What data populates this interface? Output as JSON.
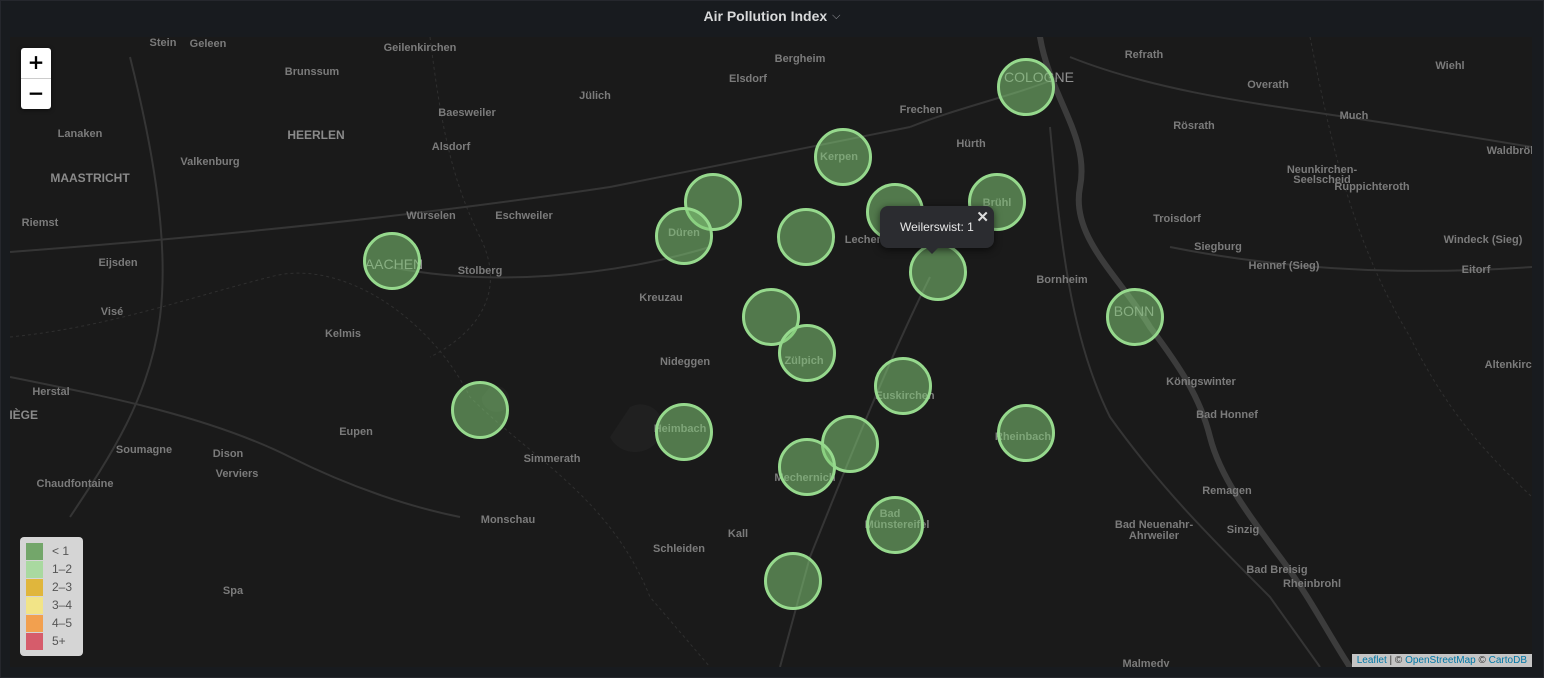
{
  "panel": {
    "title": "Air Pollution Index",
    "caret": "⌵"
  },
  "map": {
    "zoom_in": "+",
    "zoom_out": "−",
    "places": [
      {
        "name": "Stein",
        "c": "place"
      },
      {
        "name": "Geleen",
        "c": "place"
      },
      {
        "name": "Geilenkirchen",
        "c": "place"
      },
      {
        "name": "Brunssum",
        "c": "place"
      },
      {
        "name": "HEERLEN",
        "c": "place big"
      },
      {
        "name": "Lanaken",
        "c": "place"
      },
      {
        "name": "Valkenburg",
        "c": "place"
      },
      {
        "name": "MAASTRICHT",
        "c": "place big"
      },
      {
        "name": "Riemst",
        "c": "place"
      },
      {
        "name": "Eijsden",
        "c": "place"
      },
      {
        "name": "Visé",
        "c": "place"
      },
      {
        "name": "Herstal",
        "c": "place"
      },
      {
        "name": "LIÈGE",
        "c": "place big"
      },
      {
        "name": "Soumagne",
        "c": "place"
      },
      {
        "name": "Chaudfontaine",
        "c": "place"
      },
      {
        "name": "Dison",
        "c": "place"
      },
      {
        "name": "Verviers",
        "c": "place"
      },
      {
        "name": "Spa",
        "c": "place"
      },
      {
        "name": "Baesweiler",
        "c": "place"
      },
      {
        "name": "Alsdorf",
        "c": "place"
      },
      {
        "name": "Würselen",
        "c": "place"
      },
      {
        "name": "Eschweiler",
        "c": "place"
      },
      {
        "name": "Stolberg",
        "c": "place"
      },
      {
        "name": "Kelmis",
        "c": "place"
      },
      {
        "name": "Eupen",
        "c": "place"
      },
      {
        "name": "Simmerath",
        "c": "place"
      },
      {
        "name": "Monschau",
        "c": "place"
      },
      {
        "name": "Jülich",
        "c": "place"
      },
      {
        "name": "Elsdorf",
        "c": "place"
      },
      {
        "name": "Bergheim",
        "c": "place"
      },
      {
        "name": "Kreuzau",
        "c": "place"
      },
      {
        "name": "Nideggen",
        "c": "place"
      },
      {
        "name": "Schleiden",
        "c": "place"
      },
      {
        "name": "Kall",
        "c": "place"
      },
      {
        "name": "Frechen",
        "c": "place"
      },
      {
        "name": "Hürth",
        "c": "place"
      },
      {
        "name": "Refrath",
        "c": "place"
      },
      {
        "name": "Overath",
        "c": "place"
      },
      {
        "name": "Wiehl",
        "c": "place"
      },
      {
        "name": "Much",
        "c": "place"
      },
      {
        "name": "Rösrath",
        "c": "place"
      },
      {
        "name": "Neunkirchen-",
        "c": "place"
      },
      {
        "name": "Seelscheid",
        "c": "place"
      },
      {
        "name": "Ruppichteroth",
        "c": "place"
      },
      {
        "name": "Waldbröl",
        "c": "place"
      },
      {
        "name": "Troisdorf",
        "c": "place"
      },
      {
        "name": "Siegburg",
        "c": "place"
      },
      {
        "name": "Hennef (Sieg)",
        "c": "place"
      },
      {
        "name": "Windeck (Sieg)",
        "c": "place"
      },
      {
        "name": "Eitorf",
        "c": "place"
      },
      {
        "name": "Bornheim",
        "c": "place"
      },
      {
        "name": "Königswinter",
        "c": "place"
      },
      {
        "name": "Bad Honnef",
        "c": "place"
      },
      {
        "name": "Remagen",
        "c": "place"
      },
      {
        "name": "Bad Neuenahr-",
        "c": "place"
      },
      {
        "name": "Ahrweiler",
        "c": "place"
      },
      {
        "name": "Sinzig",
        "c": "place"
      },
      {
        "name": "Bad Breisig",
        "c": "place"
      },
      {
        "name": "Rheinbrohl",
        "c": "place"
      },
      {
        "name": "Altenkirchen",
        "c": "place"
      },
      {
        "name": "Malmedy",
        "c": "place"
      },
      {
        "name": "Kerpen",
        "c": "place"
      },
      {
        "name": "Düren",
        "c": "place"
      },
      {
        "name": "Zülpich",
        "c": "place"
      },
      {
        "name": "Euskirchen",
        "c": "place"
      },
      {
        "name": "Heimbach",
        "c": "place"
      },
      {
        "name": "Mechernich",
        "c": "place"
      },
      {
        "name": "Bad",
        "c": "place"
      },
      {
        "name": "Münstereifel",
        "c": "place"
      },
      {
        "name": "Rheinbach",
        "c": "place"
      },
      {
        "name": "Brühl",
        "c": "place"
      },
      {
        "name": "COLOGNE",
        "c": "place city"
      },
      {
        "name": "AACHEN",
        "c": "place city"
      },
      {
        "name": "BONN",
        "c": "place city"
      },
      {
        "name": "Lechenich",
        "c": "place"
      }
    ],
    "popup": {
      "text": "Weilerswist: 1",
      "close": "✕"
    },
    "legend": [
      {
        "label": "< 1",
        "color": "#73a66a"
      },
      {
        "label": "1–2",
        "color": "#a9d9a0"
      },
      {
        "label": "2–3",
        "color": "#e0b63c"
      },
      {
        "label": "3–4",
        "color": "#f2e487"
      },
      {
        "label": "4–5",
        "color": "#f2a04f"
      },
      {
        "label": "5+",
        "color": "#d65c6b"
      }
    ],
    "attribution": {
      "leaflet": "Leaflet",
      "sep1": " | © ",
      "osm": "OpenStreetMap",
      "sep2": " © ",
      "carto": "CartoDB"
    }
  }
}
